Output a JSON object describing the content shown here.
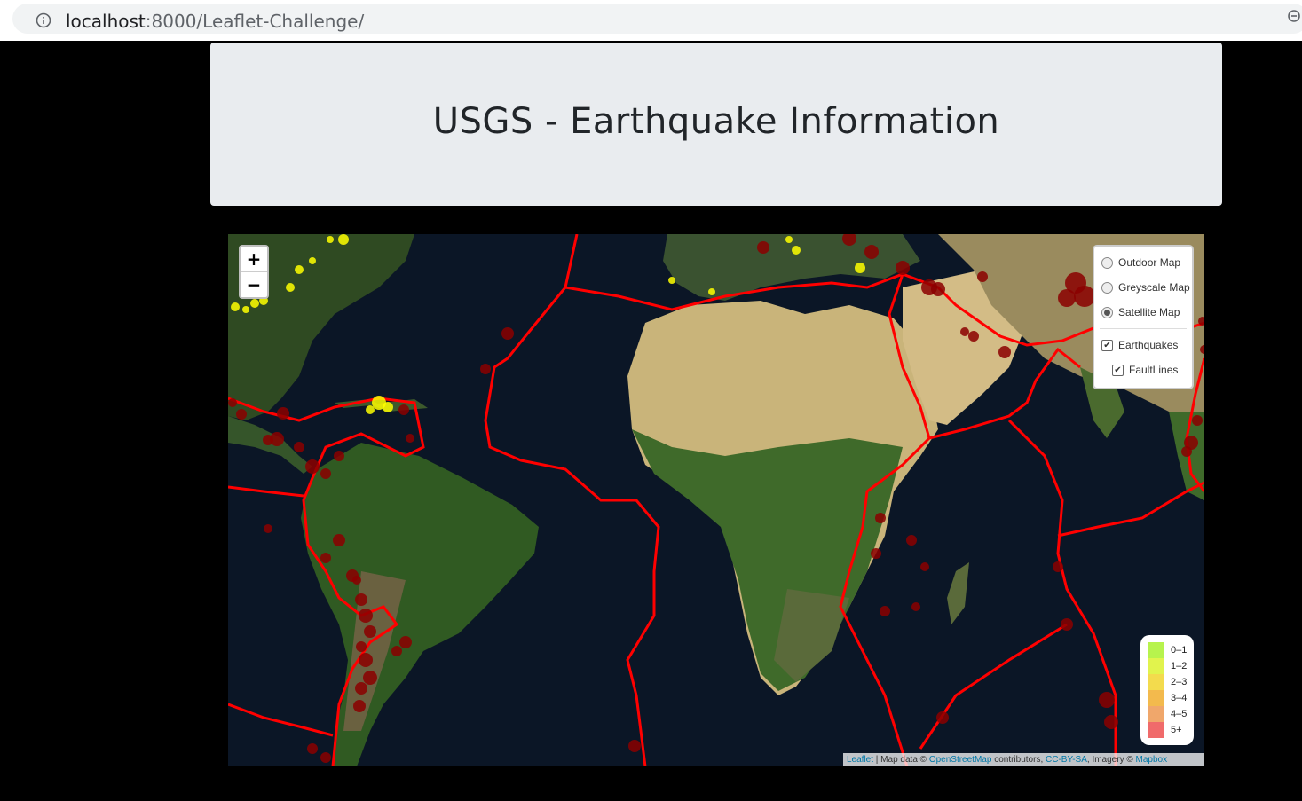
{
  "browser": {
    "url_host": "localhost",
    "url_rest": ":8000/Leaflet-Challenge/"
  },
  "header": {
    "title": "USGS - Earthquake Information"
  },
  "map": {
    "zoom_in": "+",
    "zoom_out": "−",
    "base_layers": [
      {
        "label": "Outdoor Map",
        "selected": false
      },
      {
        "label": "Greyscale Map",
        "selected": false
      },
      {
        "label": "Satellite Map",
        "selected": true
      }
    ],
    "overlays": [
      {
        "label": "Earthquakes",
        "checked": true
      },
      {
        "label": "FaultLines",
        "checked": true
      }
    ],
    "legend": [
      {
        "label": "0–1",
        "color": "#b7f34d"
      },
      {
        "label": "1–2",
        "color": "#e1f34d"
      },
      {
        "label": "2–3",
        "color": "#f3db4d"
      },
      {
        "label": "3–4",
        "color": "#f3ba4d"
      },
      {
        "label": "4–5",
        "color": "#f0a76b"
      },
      {
        "label": "5+",
        "color": "#f06b6b"
      }
    ],
    "attribution": {
      "leaflet": "Leaflet",
      "sep": " | Map data © ",
      "osm": "OpenStreetMap",
      "contrib": " contributors, ",
      "license": "CC-BY-SA",
      "imagery": ", Imagery © ",
      "mapbox": "Mapbox"
    },
    "colors": {
      "ocean": "#0b1626",
      "fault_line": "#ff0000",
      "quake_large": "#8b0000",
      "quake_small": "#ffff00"
    }
  }
}
